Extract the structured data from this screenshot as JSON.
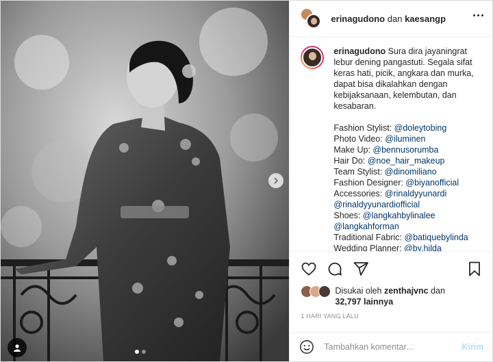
{
  "header": {
    "user1": "erinagudono",
    "connector": "dan",
    "user2": "kaesangp",
    "more_icon": "more-horizontal-icon"
  },
  "caption": {
    "username": "erinagudono",
    "text": "Sura dira jayaningrat lebur dening pangastuti. Segala sifat keras hati, picik, angkara dan murka, dapat bisa dikalahkan dengan kebijaksanaan, kelembutan, dan kesabaran.",
    "credits": [
      {
        "label": "Fashion Stylist: ",
        "handle": "@doleytobing"
      },
      {
        "label": "Photo Video: ",
        "handle": "@iluminen"
      },
      {
        "label": "Make Up: ",
        "handle": "@bennusorumba"
      },
      {
        "label": "Hair Do: ",
        "handle": "@noe_hair_makeup"
      },
      {
        "label": "Team Stylist: ",
        "handle": "@dinomiliano"
      },
      {
        "label": "Fashion Designer: ",
        "handle": "@biyanofficial"
      },
      {
        "label": "Accessories: ",
        "handle": "@rinaldyyunardi"
      },
      {
        "label": "",
        "handle": "@rinaldyyunardiofficial"
      },
      {
        "label": "Shoes: ",
        "handle": "@langkahbylinalee"
      },
      {
        "label": "",
        "handle": "@langkahforman"
      },
      {
        "label": "Traditional Fabric: ",
        "handle": "@batiquebylinda"
      },
      {
        "label": "Wedding Planner: ",
        "handle": "@by.hilda"
      }
    ]
  },
  "likes": {
    "prefix": "Disukai oleh",
    "user": "zenthajvnc",
    "connector": "dan",
    "count": "32,797",
    "suffix": "lainnya"
  },
  "timestamp": "1 HARI YANG LALU",
  "comment": {
    "placeholder": "Tambahkan komentar...",
    "post_label": "Kirim"
  },
  "carousel": {
    "slide_count": 2,
    "active_index": 0
  },
  "colors": {
    "link": "#00376b",
    "muted": "#8e8e8e",
    "post_disabled": "#b2dffc",
    "text": "#262626"
  }
}
